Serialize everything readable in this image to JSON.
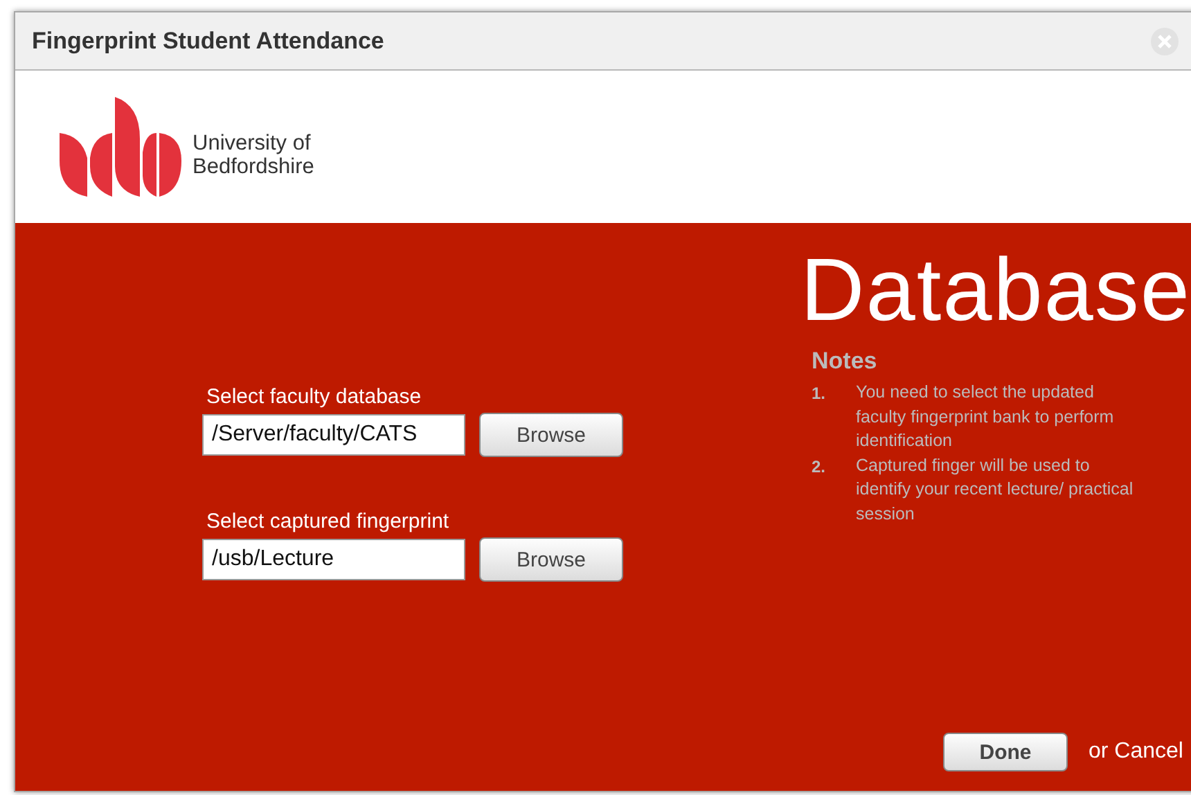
{
  "window": {
    "title": "Fingerprint Student Attendance"
  },
  "logo": {
    "line_1": "University of",
    "line_2": "Bedfordshire"
  },
  "heading": "Database",
  "form": [
    {
      "label": "Select faculty database",
      "value": "/Server/faculty/CATS",
      "button": "Browse"
    },
    {
      "label": "Select captured fingerprint",
      "value": "/usb/Lecture",
      "button": "Browse"
    }
  ],
  "notes": {
    "title": "Notes",
    "items": [
      {
        "number": "1.",
        "text": "You need to select the updated faculty fingerprint bank to perform identification"
      },
      {
        "number": "2.",
        "text": "Captured finger will be used to identify your recent lecture/ practical session"
      }
    ]
  },
  "footer": {
    "done": "Done",
    "cancel": "or Cancel"
  }
}
